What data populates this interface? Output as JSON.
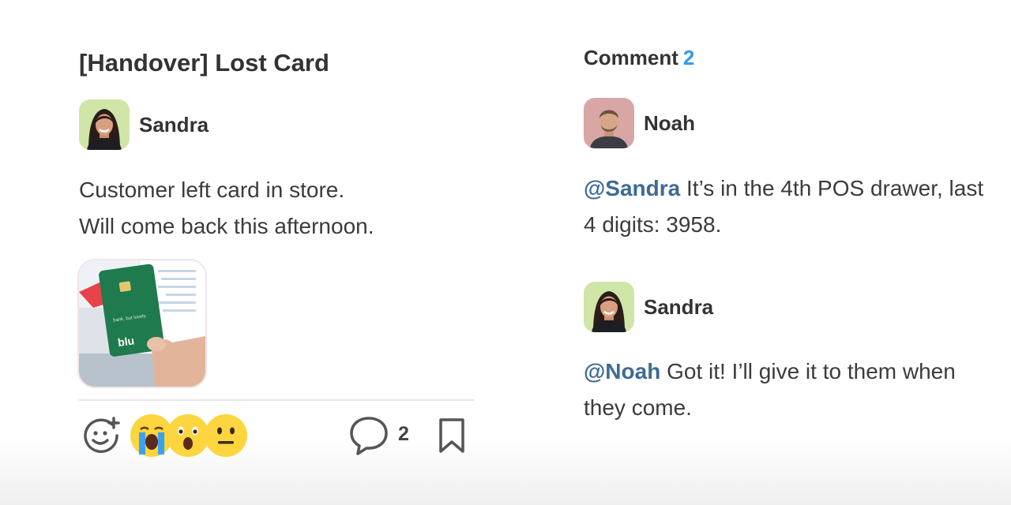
{
  "post": {
    "title": "[Handover] Lost Card",
    "author": {
      "name": "Sandra"
    },
    "body_lines": [
      "Customer left card in store.",
      "Will come back this afternoon."
    ],
    "attachment": {
      "card_tagline": "bank, but lovely.",
      "card_brand": "blu"
    },
    "actions": {
      "add_reaction_icon": "add-reaction-smiley-icon",
      "reactions": [
        "crying-face",
        "astonished-face",
        "neutral-face"
      ],
      "comment_icon": "speech-bubble-icon",
      "comment_count": "2",
      "bookmark_icon": "bookmark-icon"
    }
  },
  "comments": {
    "label": "Comment",
    "count": "2",
    "items": [
      {
        "author": "Noah",
        "mention": "@Sandra",
        "text": " It’s in the 4th POS drawer, last 4 digits: 3958."
      },
      {
        "author": "Sandra",
        "mention": "@Noah",
        "text": " Got it! I’ll give it to them when they come."
      }
    ]
  },
  "colors": {
    "accent_count": "#3399ee",
    "mention": "#3d6b94",
    "text": "#333333",
    "divider": "#e6e6e6",
    "emoji_yellow": "#fcd53f"
  }
}
